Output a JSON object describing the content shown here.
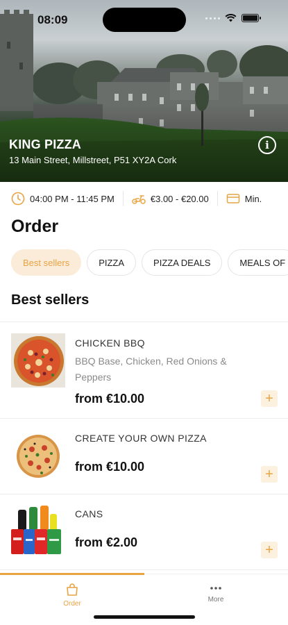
{
  "status_bar": {
    "time": "08:09"
  },
  "store": {
    "name": "KING PIZZA",
    "address": "13 Main Street, Millstreet, P51 XY2A Cork"
  },
  "info_row": {
    "hours": "04:00 PM - 11:45 PM",
    "delivery_fee": "€3.00 - €20.00",
    "minimum": "Min."
  },
  "page_title": "Order",
  "categories": [
    {
      "label": "Best sellers",
      "active": true
    },
    {
      "label": "PIZZA",
      "active": false
    },
    {
      "label": "PIZZA DEALS",
      "active": false
    },
    {
      "label": "MEALS OF",
      "active": false
    }
  ],
  "section_title": "Best sellers",
  "products": [
    {
      "name": "CHICKEN BBQ",
      "description": "BBQ Base, Chicken, Red Onions & Peppers",
      "price": "from €10.00",
      "image": "pizza-photo"
    },
    {
      "name": "CREATE YOUR OWN PIZZA",
      "description": "",
      "price": "from €10.00",
      "image": "pizza-photo"
    },
    {
      "name": "CANS",
      "description": "",
      "price": "from €2.00",
      "image": "soft-drinks-photo"
    }
  ],
  "tabbar": {
    "order_label": "Order",
    "more_label": "More"
  },
  "colors": {
    "accent": "#e8a343",
    "accent_light": "#fbecd9",
    "text": "#111111"
  }
}
